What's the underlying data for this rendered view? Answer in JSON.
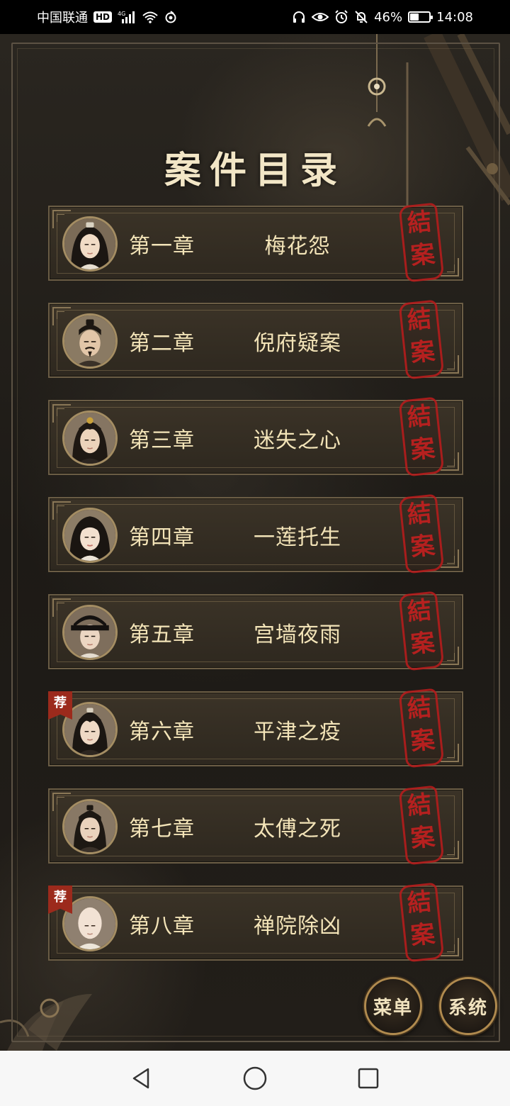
{
  "status_bar": {
    "carrier": "中国联通",
    "hd": "HD",
    "network": "4G",
    "battery_text": "46%",
    "battery_level": 0.46,
    "time": "14:08"
  },
  "page": {
    "title": "案件目录"
  },
  "chapters": [
    {
      "number": "第一章",
      "title": "梅花怨",
      "seal": [
        "結",
        "案"
      ],
      "recommended": false
    },
    {
      "number": "第二章",
      "title": "倪府疑案",
      "seal": [
        "結",
        "案"
      ],
      "recommended": false
    },
    {
      "number": "第三章",
      "title": "迷失之心",
      "seal": [
        "結",
        "案"
      ],
      "recommended": false
    },
    {
      "number": "第四章",
      "title": "一莲托生",
      "seal": [
        "結",
        "案"
      ],
      "recommended": false
    },
    {
      "number": "第五章",
      "title": "宫墙夜雨",
      "seal": [
        "結",
        "案"
      ],
      "recommended": false
    },
    {
      "number": "第六章",
      "title": "平津之疫",
      "seal": [
        "結",
        "案"
      ],
      "recommended": true,
      "tag": "荐"
    },
    {
      "number": "第七章",
      "title": "太傅之死",
      "seal": [
        "結",
        "案"
      ],
      "recommended": false
    },
    {
      "number": "第八章",
      "title": "禅院除凶",
      "seal": [
        "結",
        "案"
      ],
      "recommended": true,
      "tag": "荐"
    }
  ],
  "buttons": {
    "menu": "菜单",
    "system": "系统"
  },
  "colors": {
    "accent_gold": "#f3e4b8",
    "seal_red": "#c41f1f",
    "panel_border": "#6b5d45"
  }
}
